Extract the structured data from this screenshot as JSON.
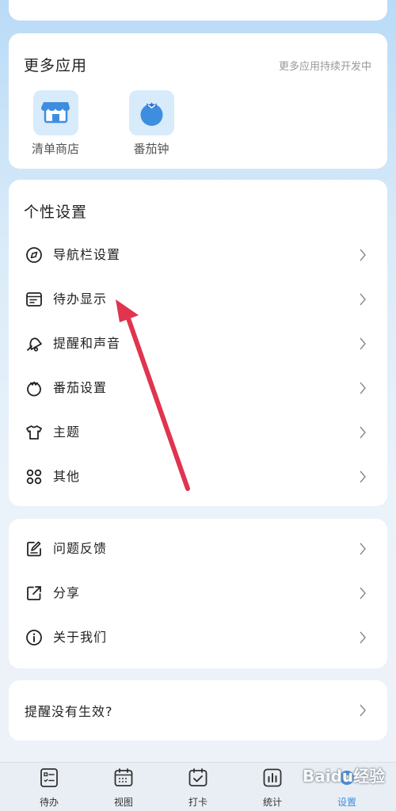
{
  "more_apps": {
    "title": "更多应用",
    "note": "更多应用持续开发中",
    "apps": [
      {
        "label": "清单商店",
        "icon": "store-icon"
      },
      {
        "label": "番茄钟",
        "icon": "tomato-clock-icon"
      }
    ]
  },
  "personal_settings": {
    "title": "个性设置",
    "items": [
      {
        "label": "导航栏设置",
        "icon": "navigation-compass-icon"
      },
      {
        "label": "待办显示",
        "icon": "todo-display-icon"
      },
      {
        "label": "提醒和声音",
        "icon": "bell-icon"
      },
      {
        "label": "番茄设置",
        "icon": "tomato-icon"
      },
      {
        "label": "主题",
        "icon": "tshirt-icon"
      },
      {
        "label": "其他",
        "icon": "apps-grid-icon"
      }
    ]
  },
  "support": {
    "items": [
      {
        "label": "问题反馈",
        "icon": "feedback-icon"
      },
      {
        "label": "分享",
        "icon": "share-icon"
      },
      {
        "label": "关于我们",
        "icon": "info-icon"
      }
    ]
  },
  "help": {
    "label": "提醒没有生效?"
  },
  "tabs": [
    {
      "label": "待办",
      "icon": "todo-list-icon",
      "active": false
    },
    {
      "label": "视图",
      "icon": "calendar-view-icon",
      "active": false
    },
    {
      "label": "打卡",
      "icon": "checkin-icon",
      "active": false
    },
    {
      "label": "统计",
      "icon": "statistics-icon",
      "active": false
    },
    {
      "label": "设置",
      "icon": "settings-icon",
      "active": true
    }
  ],
  "watermark": "Baidu经验",
  "colors": {
    "accent": "#3e8ee0",
    "annotation_arrow": "#e0344f",
    "app_icon_bg": "#d8ebfb"
  }
}
